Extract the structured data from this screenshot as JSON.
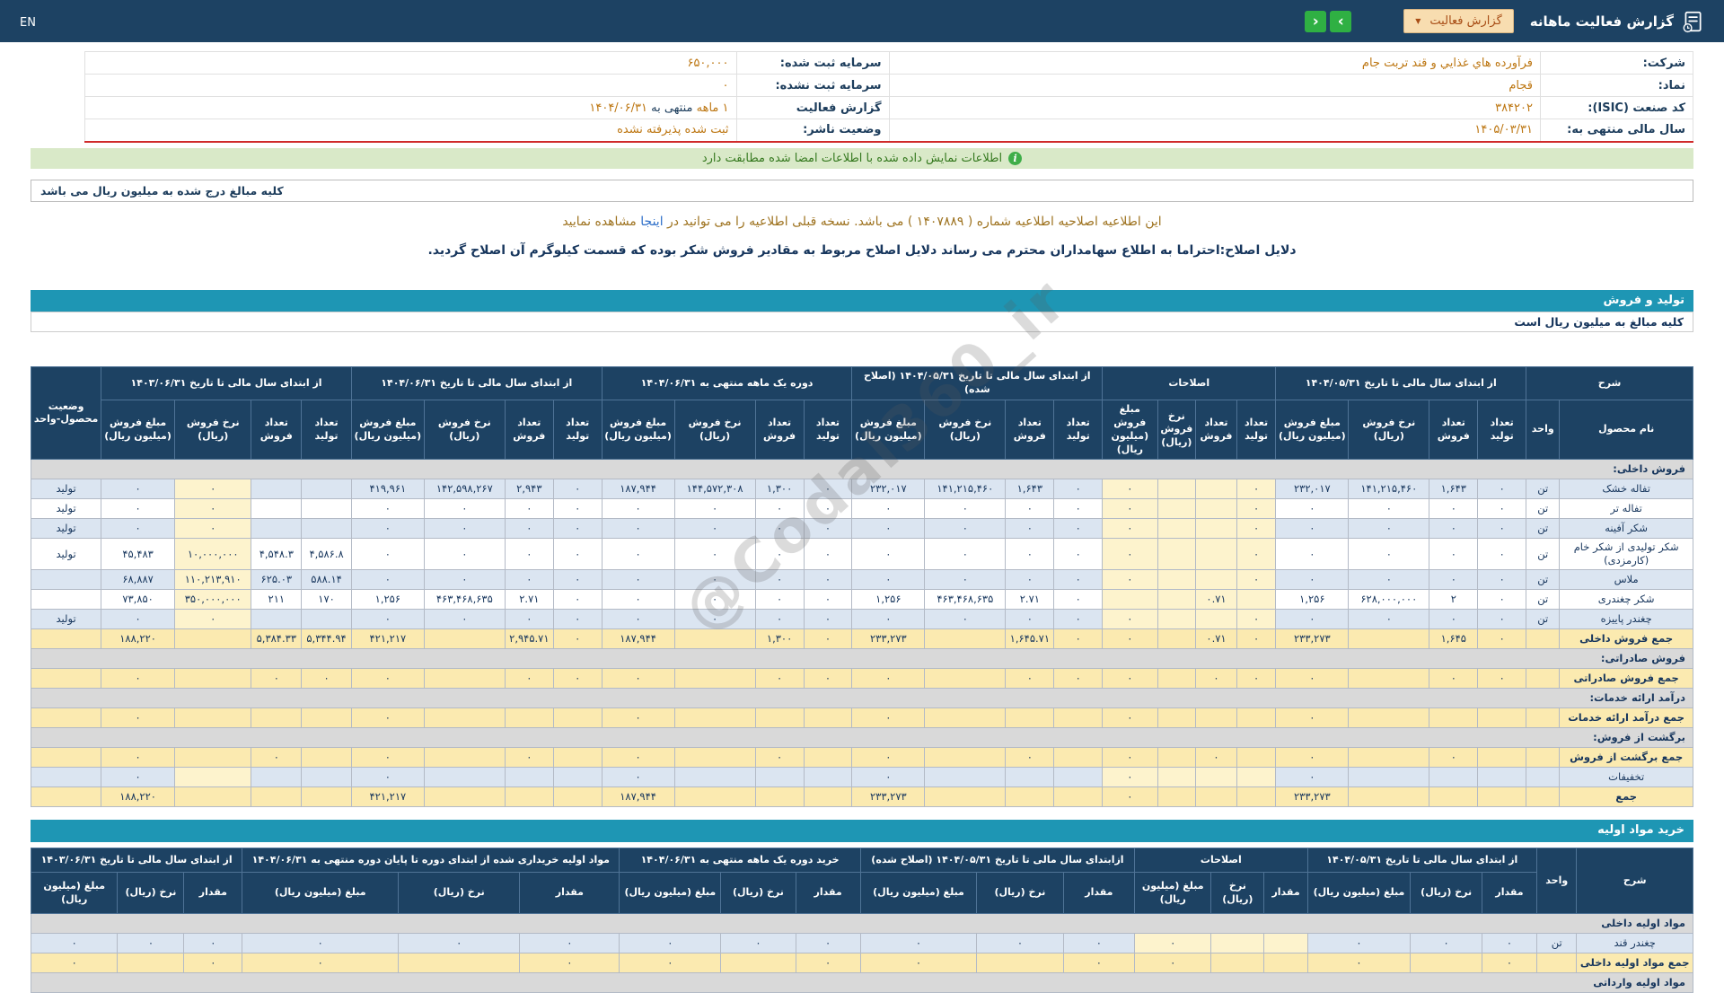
{
  "navbar": {
    "title": "گزارش فعالیت ماهانه",
    "dropdown_label": "گزارش فعالیت",
    "dropdown_caret": "▼",
    "next_label": "›",
    "prev_label": "‹",
    "lang": "EN"
  },
  "company": {
    "right_rows": [
      {
        "label": "شرکت:",
        "value": "فرآورده هاي غذايي و قند تربت جام"
      },
      {
        "label": "نماد:",
        "value": "قجام"
      },
      {
        "label": "کد صنعت (ISIC):",
        "value": "۳۸۴۲۰۲"
      },
      {
        "label": "سال مالی منتهی به:",
        "value": "۱۴۰۵/۰۳/۳۱"
      }
    ],
    "left_rows": [
      {
        "label": "سرمایه ثبت شده:",
        "value": "۶۵۰,۰۰۰"
      },
      {
        "label": "سرمایه ثبت نشده:",
        "value": "۰"
      },
      {
        "label": "گزارش فعالیت",
        "parts": [
          {
            "text": "۱ ماهه",
            "hl": true
          },
          {
            "text": " منتهی به ",
            "hl": false
          },
          {
            "text": "۱۴۰۴/۰۶/۳۱",
            "hl": true
          }
        ]
      },
      {
        "label": "وضعیت ناشر:",
        "value": "ثبت شده پذیرفته نشده"
      }
    ]
  },
  "info_bar": {
    "text": "اطلاعات نمایش داده شده با اطلاعات امضا شده مطابقت دارد",
    "icon": "i"
  },
  "amounts_note": "کلیه مبالغ درج شده به میلیون ریال می باشد",
  "amendment": {
    "before_link": "این اطلاعیه اصلاحیه اطلاعیه شماره ( ۱۴۰۷۸۸۹ ) می باشد. نسخه قبلی اطلاعیه را می توانید در ",
    "link_text": "اینجا",
    "after_link": " مشاهده نمایید",
    "reasons": "دلایل اصلاح:احتراما به اطلاع سهامداران محترم می رساند دلایل اصلاح مربوط به مقادیر فروش شکر بوده که قسمت کیلوگرم آن اصلاح گردید."
  },
  "watermark": "@Codal360_ir",
  "production_table": {
    "title": "تولید و فروش",
    "note": "کلیه مبالغ به میلیون ریال است",
    "col_desc": "شرح",
    "col_name": "نام محصول",
    "col_unit": "واحد",
    "col_status": "وضعیت محصول-واحد",
    "subcols": [
      "تعداد تولید",
      "تعداد فروش",
      "نرخ فروش (ریال)",
      "مبلغ فروش (میلیون ریال)"
    ],
    "groups": [
      "از ابتدای سال مالی تا تاریخ ۱۴۰۴/۰۵/۳۱",
      "اصلاحات",
      "از ابتدای سال مالی تا تاریخ ۱۴۰۴/۰۵/۳۱ (اصلاح شده)",
      "دوره یک ماهه منتهی به ۱۴۰۴/۰۶/۳۱",
      "از ابتدای سال مالی تا تاریخ ۱۴۰۴/۰۶/۳۱",
      "از ابتدای سال مالی تا تاریخ ۱۴۰۳/۰۶/۳۱"
    ],
    "rows": [
      {
        "type": "section",
        "name": "فروش داخلی:"
      },
      {
        "type": "data",
        "shade": "blue",
        "name": "تفاله خشک",
        "unit": "تن",
        "status": "تولید",
        "groups": [
          [
            "۰",
            "۱,۶۴۳",
            "۱۴۱,۲۱۵,۴۶۰",
            "۲۳۲,۰۱۷"
          ],
          [
            "۰",
            "",
            "",
            "۰"
          ],
          [
            "۰",
            "۱,۶۴۳",
            "۱۴۱,۲۱۵,۴۶۰",
            "۲۳۲,۰۱۷"
          ],
          [
            "۰",
            "۱,۳۰۰",
            "۱۴۴,۵۷۲,۳۰۸",
            "۱۸۷,۹۴۴"
          ],
          [
            "۰",
            "۲,۹۴۳",
            "۱۴۲,۵۹۸,۲۶۷",
            "۴۱۹,۹۶۱"
          ],
          [
            "",
            "",
            "۰",
            "۰"
          ]
        ]
      },
      {
        "type": "data",
        "shade": "white",
        "name": "تفاله تر",
        "unit": "تن",
        "status": "تولید",
        "groups": [
          [
            "۰",
            "۰",
            "۰",
            "۰"
          ],
          [
            "۰",
            "",
            "",
            "۰"
          ],
          [
            "۰",
            "۰",
            "۰",
            "۰"
          ],
          [
            "۰",
            "۰",
            "۰",
            "۰"
          ],
          [
            "۰",
            "۰",
            "۰",
            "۰"
          ],
          [
            "",
            "",
            "۰",
            "۰"
          ]
        ]
      },
      {
        "type": "data",
        "shade": "blue",
        "name": "شکر آفینه",
        "unit": "تن",
        "status": "تولید",
        "groups": [
          [
            "۰",
            "۰",
            "۰",
            "۰"
          ],
          [
            "۰",
            "",
            "",
            "۰"
          ],
          [
            "۰",
            "۰",
            "۰",
            "۰"
          ],
          [
            "۰",
            "۰",
            "۰",
            "۰"
          ],
          [
            "۰",
            "۰",
            "۰",
            "۰"
          ],
          [
            "",
            "",
            "۰",
            "۰"
          ]
        ]
      },
      {
        "type": "data",
        "shade": "white",
        "name": "شکر تولیدی از شکر خام (کارمزدی)",
        "unit": "تن",
        "status": "تولید",
        "groups": [
          [
            "۰",
            "۰",
            "۰",
            "۰"
          ],
          [
            "۰",
            "",
            "",
            "۰"
          ],
          [
            "۰",
            "۰",
            "۰",
            "۰"
          ],
          [
            "۰",
            "۰",
            "۰",
            "۰"
          ],
          [
            "۰",
            "۰",
            "۰",
            "۰"
          ],
          [
            "۴,۵۸۶.۸",
            "۴,۵۴۸.۳",
            "۱۰,۰۰۰,۰۰۰",
            "۴۵,۴۸۳"
          ]
        ]
      },
      {
        "type": "data",
        "shade": "blue",
        "name": "ملاس",
        "unit": "تن",
        "status": "",
        "groups": [
          [
            "۰",
            "۰",
            "۰",
            "۰"
          ],
          [
            "۰",
            "",
            "",
            "۰"
          ],
          [
            "۰",
            "۰",
            "۰",
            "۰"
          ],
          [
            "۰",
            "۰",
            "۰",
            "۰"
          ],
          [
            "۰",
            "۰",
            "۰",
            "۰"
          ],
          [
            "۵۸۸.۱۴",
            "۶۲۵.۰۳",
            "۱۱۰,۲۱۳,۹۱۰",
            "۶۸,۸۸۷"
          ]
        ]
      },
      {
        "type": "data",
        "shade": "white",
        "name": "شکر چغندری",
        "unit": "تن",
        "status": "",
        "groups": [
          [
            "۰",
            "۲",
            "۶۲۸,۰۰۰,۰۰۰",
            "۱,۲۵۶"
          ],
          [
            "",
            "۰.۷۱",
            "",
            ""
          ],
          [
            "۰",
            "۲.۷۱",
            "۴۶۳,۴۶۸,۶۳۵",
            "۱,۲۵۶"
          ],
          [
            "۰",
            "۰",
            "۰",
            "۰"
          ],
          [
            "۰",
            "۲.۷۱",
            "۴۶۳,۴۶۸,۶۳۵",
            "۱,۲۵۶"
          ],
          [
            "۱۷۰",
            "۲۱۱",
            "۳۵۰,۰۰۰,۰۰۰",
            "۷۳,۸۵۰"
          ]
        ]
      },
      {
        "type": "data",
        "shade": "blue",
        "name": "چغندر پاییزه",
        "unit": "تن",
        "status": "تولید",
        "groups": [
          [
            "۰",
            "۰",
            "۰",
            "۰"
          ],
          [
            "۰",
            "",
            "",
            "۰"
          ],
          [
            "۰",
            "۰",
            "۰",
            "۰"
          ],
          [
            "۰",
            "۰",
            "۰",
            "۰"
          ],
          [
            "۰",
            "۰",
            "۰",
            "۰"
          ],
          [
            "",
            "",
            "۰",
            "۰"
          ]
        ]
      },
      {
        "type": "sum",
        "name": "جمع فروش داخلی",
        "groups": [
          [
            "۰",
            "۱,۶۴۵",
            "",
            "۲۳۳,۲۷۳"
          ],
          [
            "۰",
            "۰.۷۱",
            "",
            "۰"
          ],
          [
            "۰",
            "۱,۶۴۵.۷۱",
            "",
            "۲۳۳,۲۷۳"
          ],
          [
            "۰",
            "۱,۳۰۰",
            "",
            "۱۸۷,۹۴۴"
          ],
          [
            "۰",
            "۲,۹۴۵.۷۱",
            "",
            "۴۲۱,۲۱۷"
          ],
          [
            "۵,۳۴۴.۹۴",
            "۵,۳۸۴.۳۳",
            "",
            "۱۸۸,۲۲۰"
          ]
        ]
      },
      {
        "type": "section",
        "name": "فروش صادراتی:"
      },
      {
        "type": "sum",
        "name": "جمع فروش صادراتی",
        "groups": [
          [
            "۰",
            "۰",
            "",
            "۰"
          ],
          [
            "۰",
            "۰",
            "",
            "۰"
          ],
          [
            "۰",
            "۰",
            "",
            "۰"
          ],
          [
            "۰",
            "۰",
            "",
            "۰"
          ],
          [
            "۰",
            "۰",
            "",
            "۰"
          ],
          [
            "۰",
            "۰",
            "",
            "۰"
          ]
        ]
      },
      {
        "type": "section",
        "name": "درآمد ارائه خدمات:"
      },
      {
        "type": "sum",
        "name": "جمع درآمد ارائه خدمات",
        "groups": [
          [
            "",
            "",
            "",
            "۰"
          ],
          [
            "",
            "",
            "",
            "۰"
          ],
          [
            "",
            "",
            "",
            "۰"
          ],
          [
            "",
            "",
            "",
            "۰"
          ],
          [
            "",
            "",
            "",
            "۰"
          ],
          [
            "",
            "",
            "",
            "۰"
          ]
        ]
      },
      {
        "type": "section",
        "name": "برگشت از فروش:"
      },
      {
        "type": "sum",
        "name": "جمع برگشت از فروش",
        "groups": [
          [
            "",
            "۰",
            "",
            "۰"
          ],
          [
            "",
            "۰",
            "",
            "۰"
          ],
          [
            "",
            "۰",
            "",
            "۰"
          ],
          [
            "",
            "۰",
            "",
            "۰"
          ],
          [
            "",
            "۰",
            "",
            "۰"
          ],
          [
            "",
            "۰",
            "",
            "۰"
          ]
        ]
      },
      {
        "type": "data",
        "shade": "blue",
        "name": "تخفیفات",
        "unit": "",
        "status": "",
        "groups": [
          [
            "",
            "",
            "",
            "۰"
          ],
          [
            "",
            "",
            "",
            "۰"
          ],
          [
            "",
            "",
            "",
            "۰"
          ],
          [
            "",
            "",
            "",
            "۰"
          ],
          [
            "",
            "",
            "",
            "۰"
          ],
          [
            "",
            "",
            "",
            "۰"
          ]
        ]
      },
      {
        "type": "sum",
        "name": "جمع",
        "groups": [
          [
            "",
            "",
            "",
            "۲۳۳,۲۷۳"
          ],
          [
            "",
            "",
            "",
            "۰"
          ],
          [
            "",
            "",
            "",
            "۲۳۳,۲۷۳"
          ],
          [
            "",
            "",
            "",
            "۱۸۷,۹۴۴"
          ],
          [
            "",
            "",
            "",
            "۴۲۱,۲۱۷"
          ],
          [
            "",
            "",
            "",
            "۱۸۸,۲۲۰"
          ]
        ]
      }
    ]
  },
  "materials_table": {
    "title": "خرید مواد اولیه",
    "col_desc": "شرح",
    "col_unit": "واحد",
    "subcols": [
      "مقدار",
      "نرخ (ریال)",
      "مبلغ (میلیون ریال)"
    ],
    "groups": [
      "از ابتدای سال مالی تا تاریخ ۱۴۰۴/۰۵/۳۱",
      "اصلاحات",
      "ازابتدای سال مالی تا تاریخ ۱۴۰۴/۰۵/۳۱ (اصلاح شده)",
      "خرید دوره یک ماهه منتهی به ۱۴۰۴/۰۶/۳۱",
      "مواد اولیه خریداری شده از ابتدای دوره تا پایان دوره منتهی به ۱۴۰۴/۰۶/۳۱",
      "از ابتدای سال مالی تا تاریخ ۱۴۰۳/۰۶/۳۱"
    ],
    "rows": [
      {
        "type": "section",
        "name": "مواد اولیه داخلی"
      },
      {
        "type": "data",
        "shade": "blue",
        "name": "چغندر قند",
        "unit": "تن",
        "groups": [
          [
            "۰",
            "۰",
            "۰"
          ],
          [
            "",
            "",
            "۰"
          ],
          [
            "۰",
            "۰",
            "۰"
          ],
          [
            "۰",
            "۰",
            "۰"
          ],
          [
            "۰",
            "۰",
            "۰"
          ],
          [
            "۰",
            "۰",
            "۰"
          ]
        ]
      },
      {
        "type": "sum",
        "name": "جمع مواد اولیه داخلی",
        "groups": [
          [
            "۰",
            "",
            "۰"
          ],
          [
            "",
            "",
            "۰"
          ],
          [
            "۰",
            "",
            "۰"
          ],
          [
            "۰",
            "",
            "۰"
          ],
          [
            "۰",
            "",
            "۰"
          ],
          [
            "۰",
            "",
            "۰"
          ]
        ]
      },
      {
        "type": "section",
        "name": "مواد اولیه وارداتی"
      }
    ]
  }
}
